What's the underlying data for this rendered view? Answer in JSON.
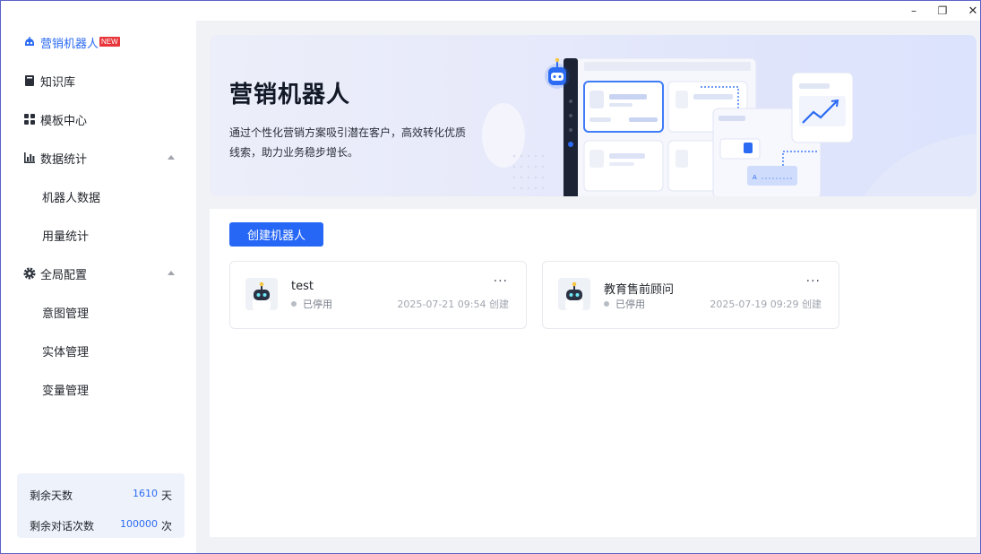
{
  "window": {
    "minimize": "–",
    "maximize": "❐",
    "close": "✕"
  },
  "sidebar": {
    "items": [
      {
        "label": "营销机器人",
        "badge": "NEW",
        "icon": "robot-icon",
        "active": true
      },
      {
        "label": "知识库",
        "icon": "book-icon"
      },
      {
        "label": "模板中心",
        "icon": "grid-icon"
      },
      {
        "label": "数据统计",
        "icon": "bar-chart-icon",
        "expanded": true
      },
      {
        "label": "全局配置",
        "icon": "gear-icon",
        "expanded": true
      }
    ],
    "stats_sub": [
      "机器人数据",
      "用量统计"
    ],
    "config_sub": [
      "意图管理",
      "实体管理",
      "变量管理"
    ],
    "quota": {
      "days_label": "剩余天数",
      "days_value": "1610",
      "days_unit": "天",
      "chats_label": "剩余对话次数",
      "chats_value": "100000",
      "chats_unit": "次"
    }
  },
  "banner": {
    "title": "营销机器人",
    "description": "通过个性化营销方案吸引潜在客户，高效转化优质线索，助力业务稳步增长。",
    "accent": "#2767f6"
  },
  "main": {
    "create_button": "创建机器人",
    "more_label": "···",
    "bots": [
      {
        "name": "test",
        "status": "已停用",
        "created": "2025-07-21 09:54 创建"
      },
      {
        "name": "教育售前顾问",
        "status": "已停用",
        "created": "2025-07-19 09:29 创建"
      }
    ]
  }
}
